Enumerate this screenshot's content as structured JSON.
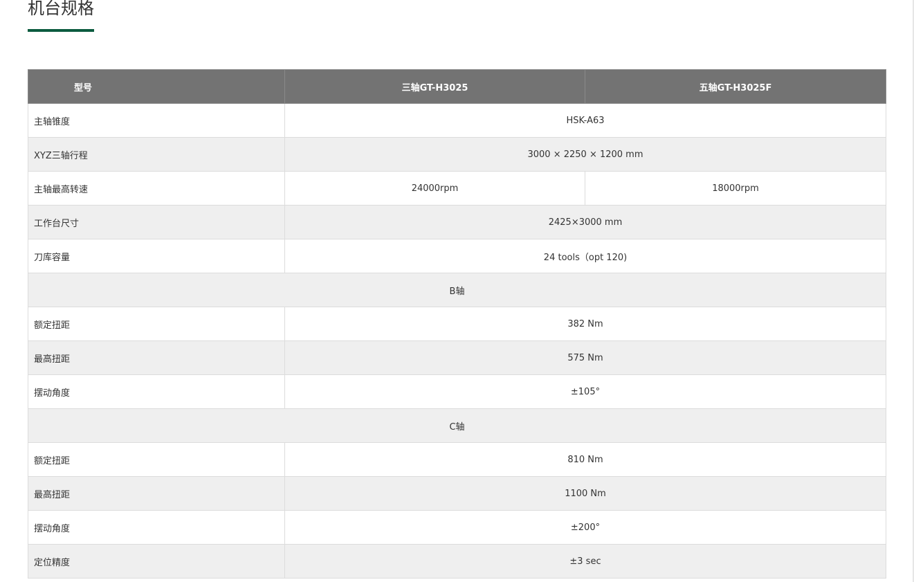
{
  "page_title": "机台规格",
  "colors": {
    "accent_underline": "#0b5b3f",
    "header_bg": "#737373",
    "row_alt_bg": "#efefef"
  },
  "table": {
    "headers": [
      "型号",
      "三轴GT-H3025",
      "五轴GT-H3025F"
    ],
    "rows": [
      {
        "type": "merged",
        "label": "主轴锥度",
        "value": "HSK-A63"
      },
      {
        "type": "merged",
        "label": "XYZ三轴行程",
        "value": "3000 × 2250 × 1200 mm"
      },
      {
        "type": "split",
        "label": "主轴最高转速",
        "values": [
          "24000rpm",
          "18000rpm"
        ]
      },
      {
        "type": "merged",
        "label": "工作台尺寸",
        "value": "2425×3000 mm"
      },
      {
        "type": "merged",
        "label": "刀库容量",
        "value": "24 tools（opt 120)"
      },
      {
        "type": "section",
        "label": "B轴"
      },
      {
        "type": "merged",
        "label": "额定扭距",
        "value": "382 Nm"
      },
      {
        "type": "merged",
        "label": "最高扭距",
        "value": "575 Nm"
      },
      {
        "type": "merged",
        "label": "摆动角度",
        "value": "±105°"
      },
      {
        "type": "section",
        "label": "C轴"
      },
      {
        "type": "merged",
        "label": "额定扭距",
        "value": "810 Nm"
      },
      {
        "type": "merged",
        "label": "最高扭距",
        "value": "1100 Nm"
      },
      {
        "type": "merged",
        "label": "摆动角度",
        "value": "±200°"
      },
      {
        "type": "merged",
        "label": "定位精度",
        "value": "±3 sec"
      }
    ]
  }
}
